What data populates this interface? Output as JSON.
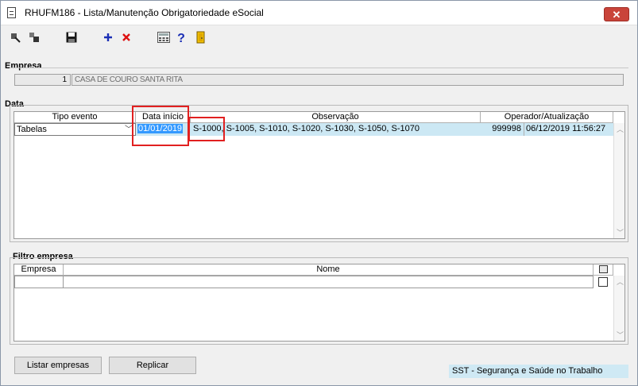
{
  "window": {
    "title": "RHUFM186 - Lista/Manutenção Obrigatoriedade eSocial",
    "close_label": "✕"
  },
  "empresa": {
    "section_label": "Empresa",
    "code": "1",
    "name": "CASA DE COURO SANTA RITA"
  },
  "data": {
    "section_label": "Data",
    "headers": {
      "tipo_evento": "Tipo evento",
      "data_inicio": "Data início",
      "observacao": "Observação",
      "operador": "Operador/Atualização"
    },
    "row": {
      "tipo_evento": "Tabelas",
      "data_inicio": "01/01/2019",
      "observacao_first": "S-1000,",
      "observacao_rest": "S-1005, S-1010, S-1020, S-1030, S-1050, S-1070",
      "operador": "999998",
      "atualizacao": "06/12/2019 11:56:27"
    }
  },
  "filtro": {
    "section_label": "Filtro empresa",
    "headers": {
      "empresa": "Empresa",
      "nome": "Nome"
    }
  },
  "buttons": {
    "listar": "Listar empresas",
    "replicar": "Replicar"
  },
  "status": {
    "text": "SST - Segurança e Saúde no Trabalho"
  },
  "colors": {
    "selected_row": "#cce8f4",
    "highlight": "#3399ff",
    "annotation_red": "#e12020",
    "close_red": "#c9443a"
  }
}
